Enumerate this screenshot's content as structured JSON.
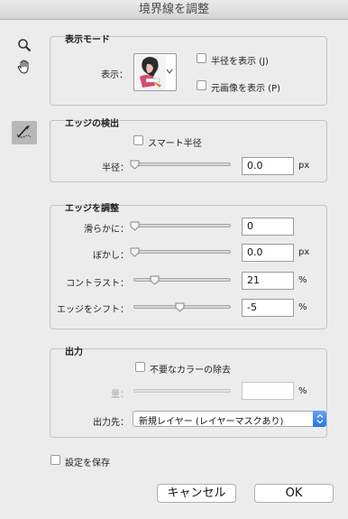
{
  "window": {
    "title": "境界線を調整"
  },
  "tools": {
    "zoom": "zoom-icon",
    "hand": "hand-icon",
    "refine_brush": "refine-radius-brush-icon"
  },
  "view_mode": {
    "title": "表示モード",
    "view_label": "表示：",
    "show_radius_label": "半径を表示 (J)",
    "show_original_label": "元画像を表示 (P)"
  },
  "edge_detection": {
    "title": "エッジの検出",
    "smart_radius_label": "スマート半径",
    "radius_label": "半径：",
    "radius_value": "0.0",
    "radius_unit": "px",
    "radius_level": 0
  },
  "adjust_edge": {
    "title": "エッジを調整",
    "smooth_label": "滑らかに：",
    "smooth_value": "0",
    "smooth_level": 0,
    "feather_label": "ぼかし：",
    "feather_value": "0.0",
    "feather_unit": "px",
    "feather_level": 0,
    "contrast_label": "コントラスト：",
    "contrast_value": "21",
    "contrast_unit": "%",
    "contrast_level": 0.21,
    "shift_label": "エッジをシフト：",
    "shift_value": "-5",
    "shift_unit": "%",
    "shift_level": 0.475
  },
  "output": {
    "title": "出力",
    "decontaminate_label": "不要なカラーの除去",
    "amount_label": "量：",
    "amount_value": "",
    "amount_unit": "%",
    "output_to_label": "出力先：",
    "output_to_value": "新規レイヤー (レイヤーマスクあり)"
  },
  "remember_label": "設定を保存",
  "buttons": {
    "cancel": "キャンセル",
    "ok": "OK"
  },
  "colors": {
    "accent": "#2a73e8",
    "background": "#ececec"
  }
}
